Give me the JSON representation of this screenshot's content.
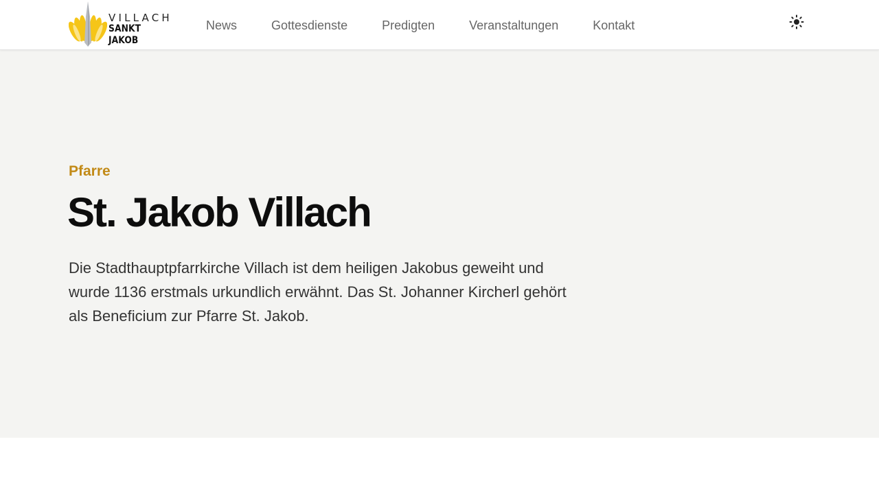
{
  "header": {
    "logo": {
      "line1": "VILLACH",
      "line2": "SANKT JAKOB",
      "colors": {
        "rays": "#f5c518",
        "rays_light": "#fbe48a",
        "tower": "#b9bcc2"
      }
    },
    "nav": [
      {
        "label": "News"
      },
      {
        "label": "Gottesdienste"
      },
      {
        "label": "Predigten"
      },
      {
        "label": "Veranstaltungen"
      },
      {
        "label": "Kontakt"
      }
    ],
    "theme_toggle_icon": "sun-icon"
  },
  "hero": {
    "eyebrow": "Pfarre",
    "title": "St. Jakob Villach",
    "lead": "Die Stadthauptpfarrkirche Villach ist dem heiligen Jakobus geweiht und wurde 1136 erstmals urkundlich erwähnt. Das St. Johanner Kircherl gehört als Beneficium zur Pfarre St. Jakob."
  },
  "colors": {
    "accent": "#c28a17",
    "hero_background": "#f4f4f2",
    "title": "#0d0d0d",
    "nav_text": "#666666"
  }
}
